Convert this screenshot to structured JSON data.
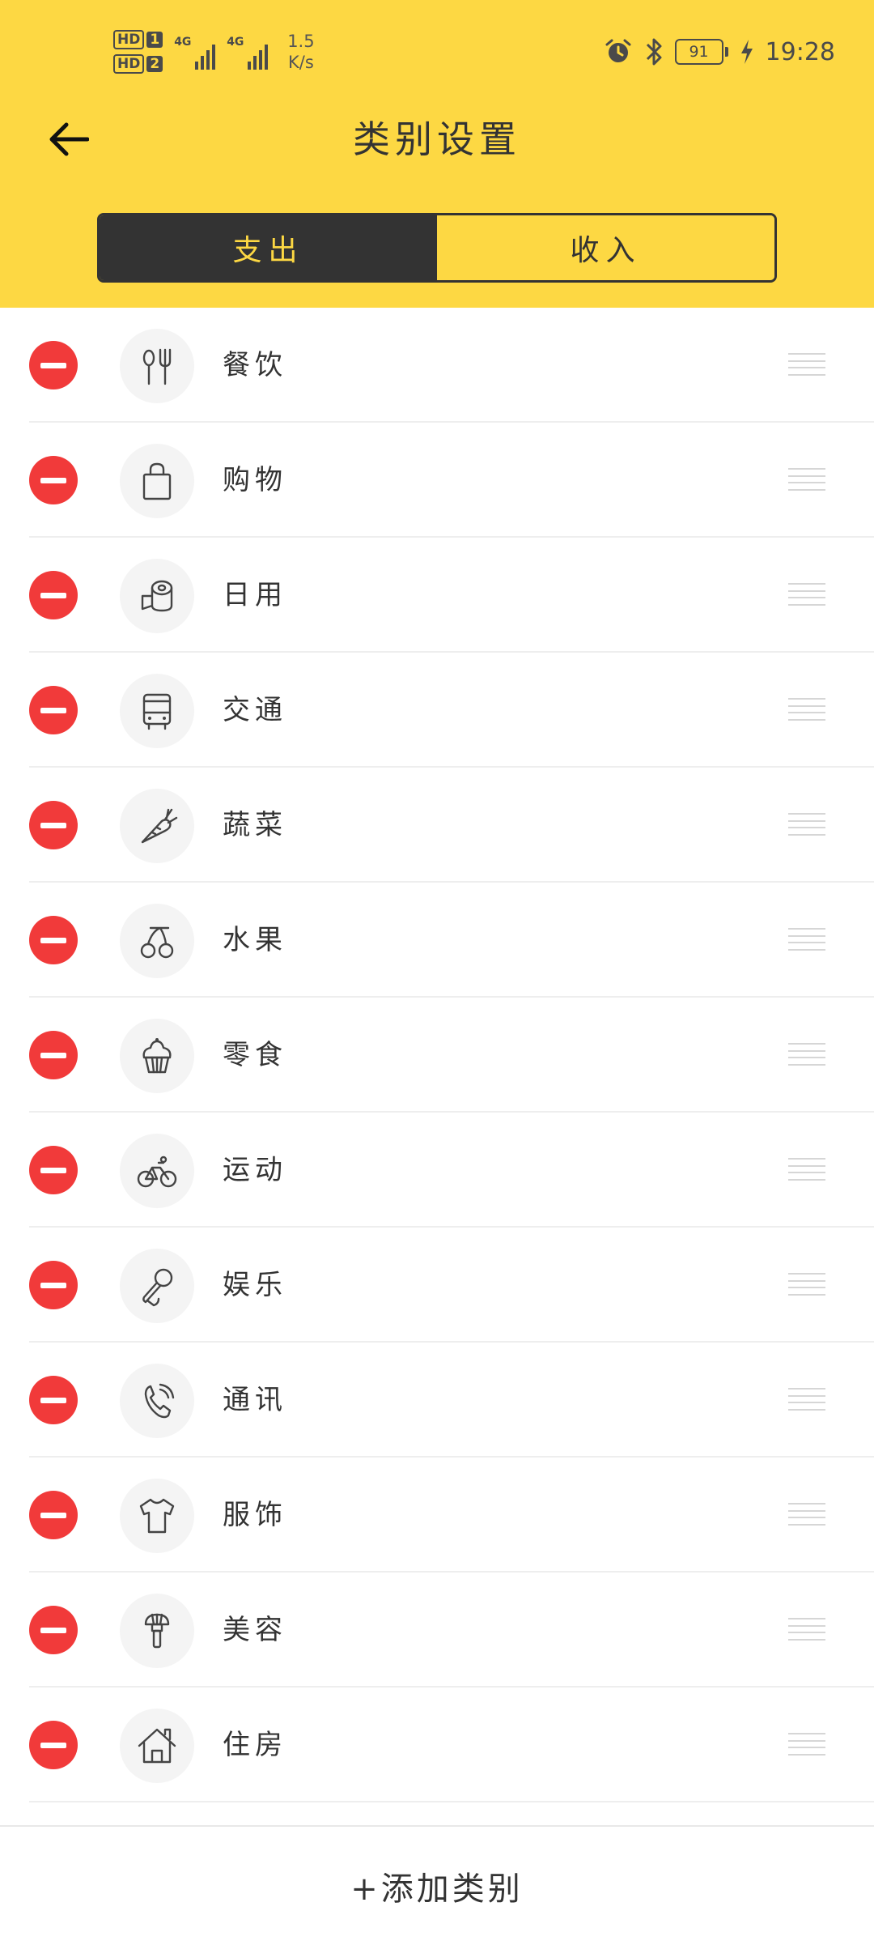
{
  "status_bar": {
    "hd1": "HD",
    "sim1": "1",
    "hd2": "HD",
    "sim2": "2",
    "net1": "4G",
    "net2": "4G",
    "speed_value": "1.5",
    "speed_unit": "K/s",
    "battery": "91",
    "time": "19:28",
    "icons": [
      "alarm-icon",
      "bluetooth-icon",
      "battery-icon",
      "charging-icon"
    ]
  },
  "header": {
    "title": "类别设置",
    "back_icon": "back-arrow-icon"
  },
  "tabs": [
    {
      "label": "支出",
      "active": true
    },
    {
      "label": "收入",
      "active": false
    }
  ],
  "categories": [
    {
      "label": "餐饮",
      "icon": "utensils-icon"
    },
    {
      "label": "购物",
      "icon": "shopping-bag-icon"
    },
    {
      "label": "日用",
      "icon": "toilet-roll-icon"
    },
    {
      "label": "交通",
      "icon": "bus-icon"
    },
    {
      "label": "蔬菜",
      "icon": "carrot-icon"
    },
    {
      "label": "水果",
      "icon": "cherry-icon"
    },
    {
      "label": "零食",
      "icon": "cupcake-icon"
    },
    {
      "label": "运动",
      "icon": "bicycle-icon"
    },
    {
      "label": "娱乐",
      "icon": "microphone-icon"
    },
    {
      "label": "通讯",
      "icon": "phone-icon"
    },
    {
      "label": "服饰",
      "icon": "tshirt-icon"
    },
    {
      "label": "美容",
      "icon": "makeup-brush-icon"
    },
    {
      "label": "住房",
      "icon": "house-icon"
    }
  ],
  "footer": {
    "add_label": "+添加类别"
  },
  "colors": {
    "header_bg": "#FDD843",
    "active_tab_bg": "#333333",
    "delete": "#F13A3A"
  }
}
